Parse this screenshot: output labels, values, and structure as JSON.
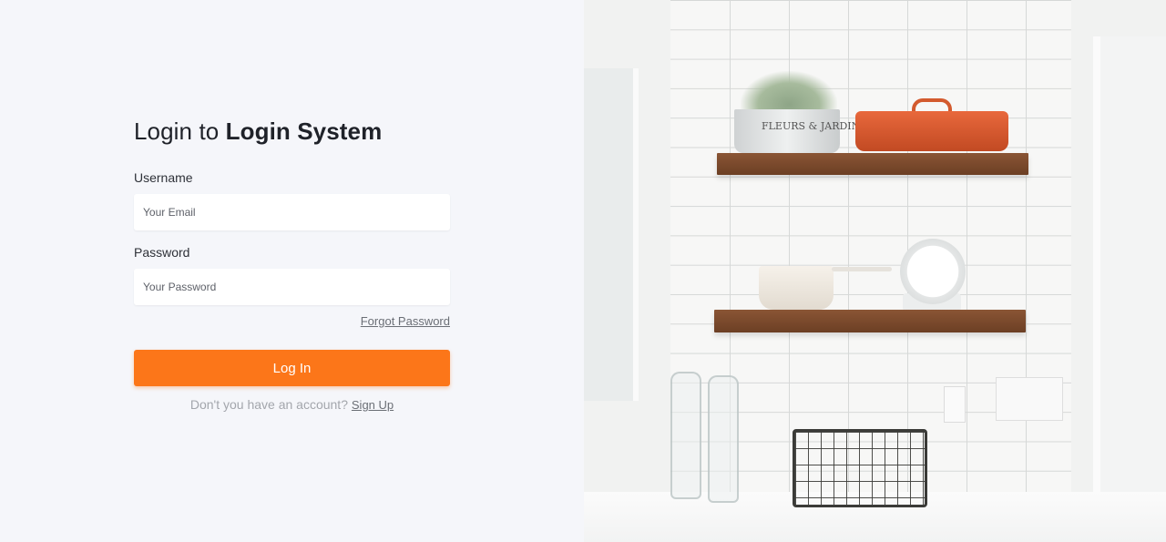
{
  "login": {
    "title_prefix": "Login to ",
    "title_brand": "Login System",
    "username_label": "Username",
    "username_placeholder": "Your Email",
    "password_label": "Password",
    "password_placeholder": "Your Password",
    "forgot_password": "Forgot Password",
    "login_button": "Log In",
    "signup_prompt": "Don't you have an account? ",
    "signup_link": "Sign Up"
  },
  "photo": {
    "pot_text": "FLEURS & JARDIN"
  },
  "colors": {
    "accent": "#fc7619",
    "background": "#f5f6fa"
  }
}
